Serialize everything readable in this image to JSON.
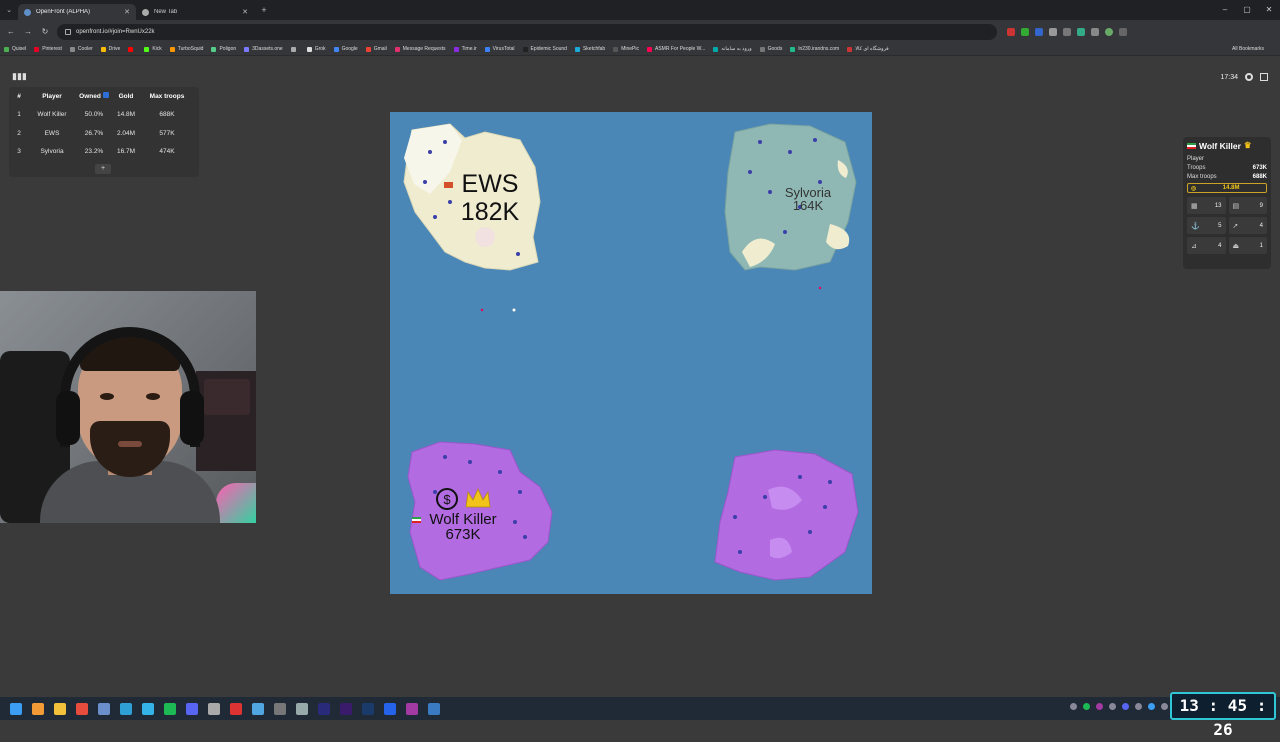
{
  "browser": {
    "tabs": [
      {
        "label": "OpenFront (ALPHA)",
        "active": true
      },
      {
        "label": "New Tab",
        "active": false
      }
    ],
    "url": "openfront.io/#join=RwnUx22k",
    "bookmarks": [
      "Quisel",
      "Pinterest",
      "Cooler",
      "Drive",
      "",
      "Kick",
      "TurboSquid",
      "Poligon",
      "3Dassets.one",
      "",
      "Grok",
      "Google",
      "Gmail",
      "Message Requests",
      "Time.ir",
      "VirusTotal",
      "Epidemic Sound",
      "Sketchfab",
      "MinePic",
      "ASMR For People W...",
      "ورود به سامانه",
      "Goods",
      "ln230.irandns.com",
      "فروشگاه ای کالا"
    ],
    "all_bookmarks": "All Bookmarks"
  },
  "leaderboard": {
    "headers": {
      "rank": "#",
      "player": "Player",
      "owned": "Owned",
      "gold": "Gold",
      "troops": "Max troops"
    },
    "rows": [
      {
        "rank": "1",
        "player": "Wolf Killer",
        "owned": "50.0%",
        "gold": "14.8M",
        "troops": "688K"
      },
      {
        "rank": "2",
        "player": "EWS",
        "owned": "26.7%",
        "gold": "2.04M",
        "troops": "577K"
      },
      {
        "rank": "3",
        "player": "Sylvoria",
        "owned": "23.2%",
        "gold": "16.7M",
        "troops": "474K"
      }
    ],
    "expand": "+"
  },
  "game_clock": "17:34",
  "map": {
    "territories": [
      {
        "name": "EWS",
        "troops": "182K",
        "color": "#efecd0"
      },
      {
        "name": "Sylvoria",
        "troops": "164K",
        "color": "#8fb8b4"
      },
      {
        "name": "Wolf Killer",
        "troops": "673K",
        "color": "#b26be0"
      }
    ],
    "water_color": "#4a86b6"
  },
  "player_panel": {
    "name": "Wolf Killer",
    "type_label": "Player",
    "troops_label": "Troops",
    "troops": "673K",
    "max_troops_label": "Max troops",
    "max_troops": "688K",
    "gold": "14.8M",
    "buildings": [
      {
        "icon": "city-icon",
        "value": "13"
      },
      {
        "icon": "factory-icon",
        "value": "9"
      },
      {
        "icon": "port-icon",
        "value": "5"
      },
      {
        "icon": "missile-silo-icon",
        "value": "4"
      },
      {
        "icon": "sam-launcher-icon",
        "value": "4"
      },
      {
        "icon": "warship-icon",
        "value": "1"
      }
    ]
  },
  "taskbar_clock": "13 : 45 : 26"
}
